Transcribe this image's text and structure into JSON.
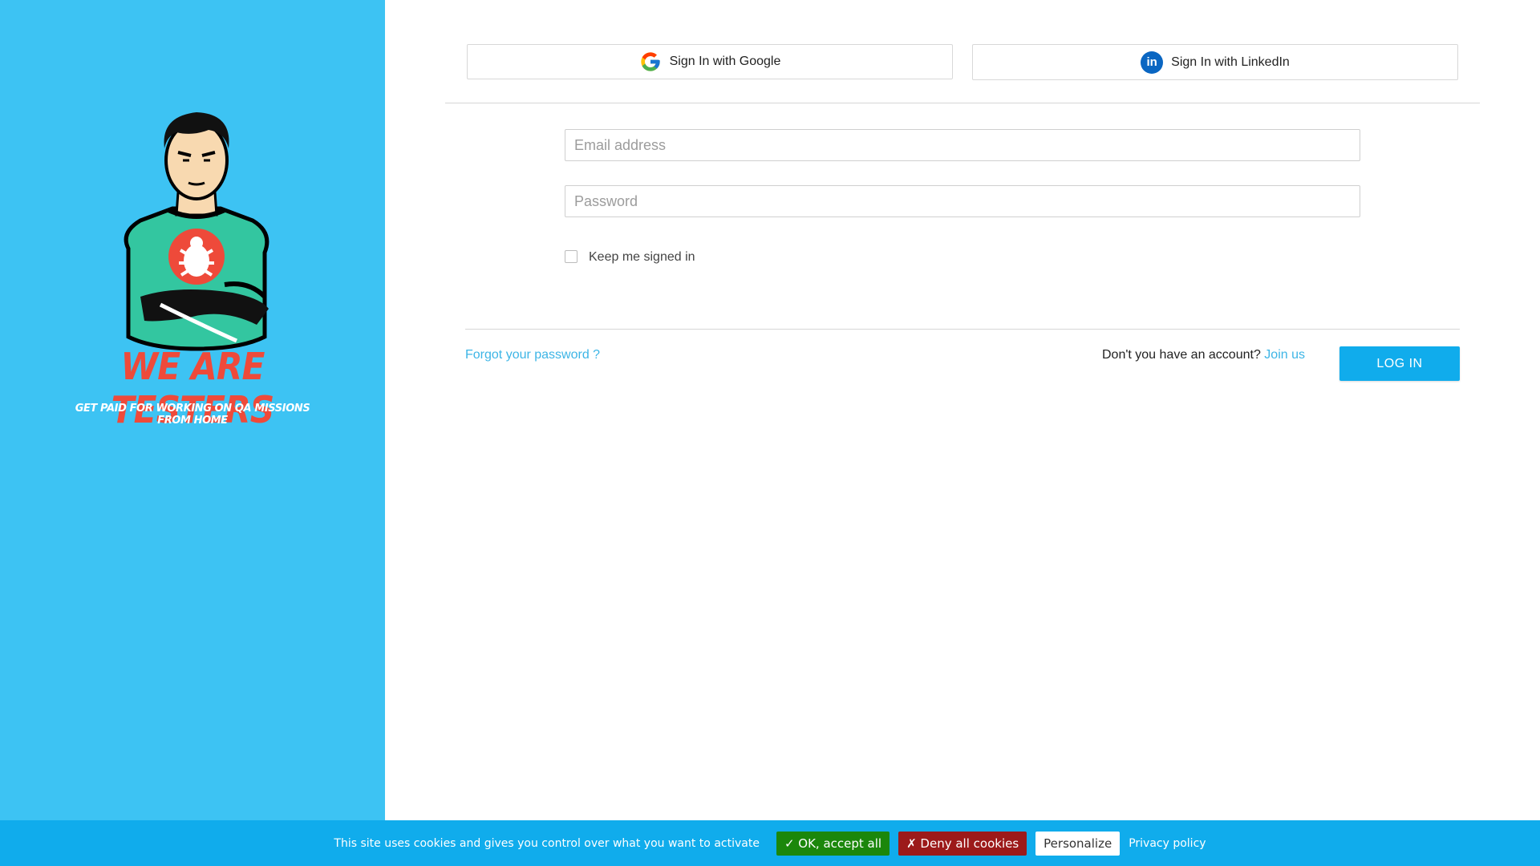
{
  "branding": {
    "title": "WE ARE TESTERS",
    "tagline": "GET PAID FOR WORKING ON QA MISSIONS FROM HOME",
    "accent_color": "#3dc3f3",
    "title_color": "#ee4a3a"
  },
  "social": {
    "google_label": "Sign In with Google",
    "linkedin_label": "Sign In with LinkedIn"
  },
  "form": {
    "email_placeholder": "Email address",
    "email_value": "",
    "password_placeholder": "Password",
    "password_value": "",
    "keep_signed_in_label": "Keep me signed in",
    "keep_signed_in_checked": false
  },
  "footer": {
    "forgot_password": "Forgot your password ?",
    "no_account_text": "Don't you have an account?",
    "join_link": "Join us",
    "login_button": "LOG IN"
  },
  "cookie_bar": {
    "message": "This site uses cookies and gives you control over what you want to activate",
    "accept_label": "✓ OK, accept all",
    "deny_label": "✗ Deny all cookies",
    "personalize_label": "Personalize",
    "privacy_label": "Privacy policy"
  }
}
